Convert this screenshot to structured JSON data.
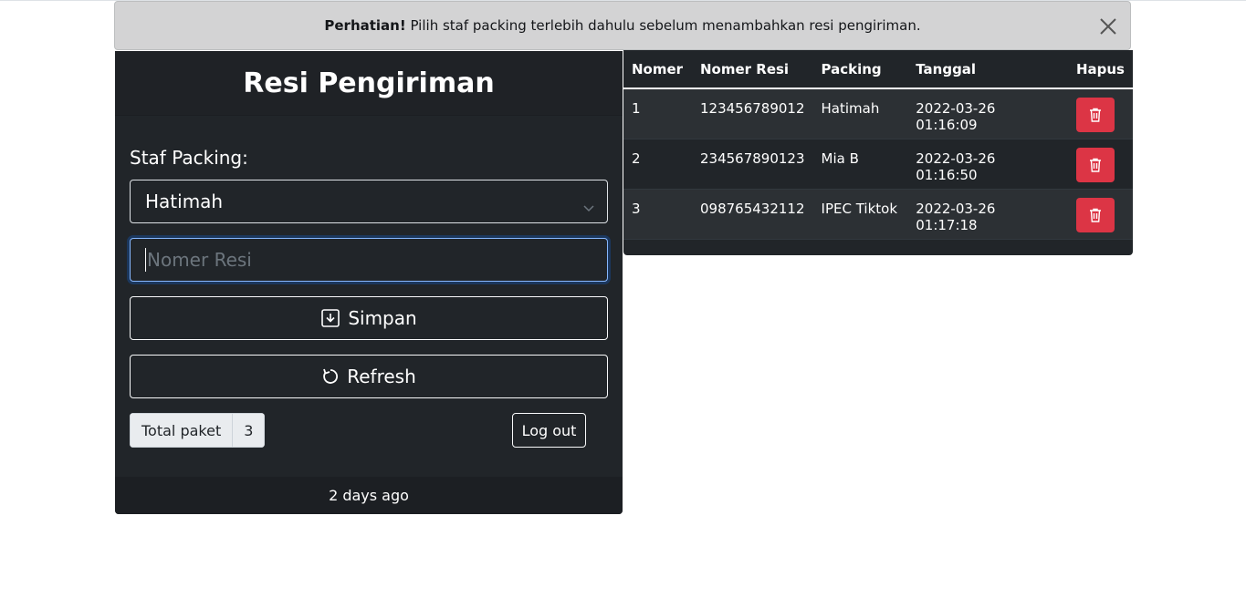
{
  "alert": {
    "strong": "Perhatian!",
    "message": " Pilih staf packing terlebih dahulu sebelum menambahkan resi pengiriman."
  },
  "card": {
    "title": "Resi Pengiriman",
    "staf_label": "Staf Packing:",
    "selected_staf": "Hatimah",
    "resi_placeholder": "Nomer Resi",
    "save_label": "Simpan",
    "refresh_label": "Refresh",
    "total_label": "Total paket",
    "total_count": "3",
    "logout_label": "Log out",
    "footer": "2 days ago"
  },
  "table": {
    "headers": [
      "Nomer",
      "Nomer Resi",
      "Packing",
      "Tanggal",
      "Hapus"
    ],
    "rows": [
      {
        "no": "1",
        "resi": "123456789012",
        "packing": "Hatimah",
        "tanggal": "2022-03-26 01:16:09"
      },
      {
        "no": "2",
        "resi": "234567890123",
        "packing": "Mia B",
        "tanggal": "2022-03-26 01:16:50"
      },
      {
        "no": "3",
        "resi": "098765432112",
        "packing": "IPEC Tiktok",
        "tanggal": "2022-03-26 01:17:18"
      }
    ]
  },
  "icons": {
    "close": "close-icon",
    "chevron": "chevron-down-icon",
    "save": "download-box-icon",
    "refresh": "refresh-icon",
    "delete": "trash-icon"
  },
  "colors": {
    "danger": "#dc3545",
    "dark": "#212529",
    "alert_bg": "#d3d3d4"
  }
}
